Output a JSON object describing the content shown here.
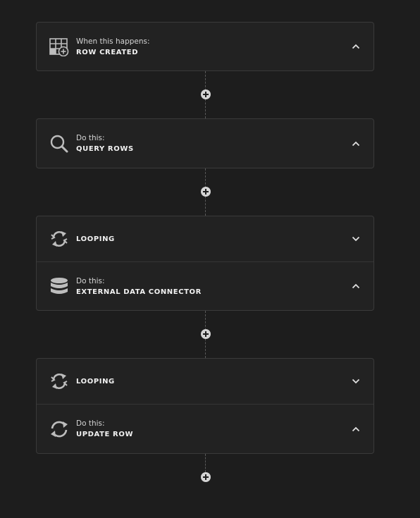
{
  "flow": {
    "trigger": {
      "label": "When this happens:",
      "name": "ROW CREATED",
      "icon": "table-add-icon",
      "expanded": true
    },
    "step1": {
      "label": "Do this:",
      "name": "QUERY ROWS",
      "icon": "search-icon",
      "expanded": true
    },
    "loop1": {
      "name": "LOOPING",
      "icon": "loop-icon",
      "expanded": false
    },
    "step2": {
      "label": "Do this:",
      "name": "EXTERNAL DATA CONNECTOR",
      "icon": "database-icon",
      "expanded": true
    },
    "loop2": {
      "name": "LOOPING",
      "icon": "loop-icon",
      "expanded": false
    },
    "step3": {
      "label": "Do this:",
      "name": "UPDATE ROW",
      "icon": "refresh-icon",
      "expanded": true
    }
  },
  "colors": {
    "background": "#1d1d1d",
    "card": "#222222",
    "border": "#3a3a3a",
    "icon": "#bdbdbd",
    "text": "#f2f2f2"
  }
}
